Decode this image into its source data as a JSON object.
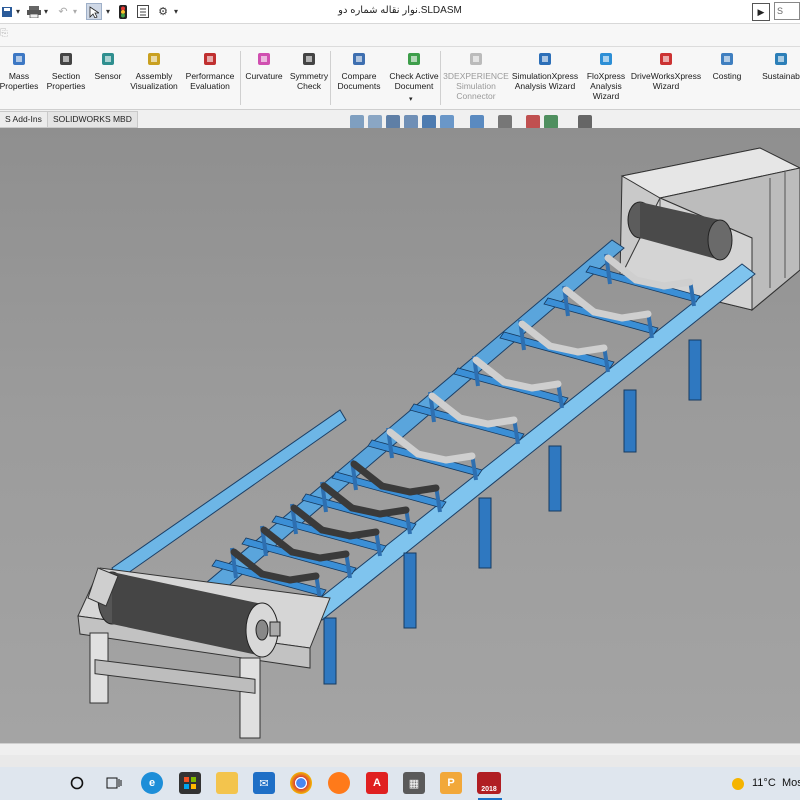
{
  "window": {
    "title": "نوار نقاله شماره دو.SLDASM"
  },
  "search": {
    "placeholder": "S"
  },
  "ribbon": {
    "buttons": [
      {
        "label": "Mass\nProperties",
        "icon": "mass-properties-icon"
      },
      {
        "label": "Section\nProperties",
        "icon": "section-properties-icon"
      },
      {
        "label": "Sensor",
        "icon": "sensor-icon"
      },
      {
        "label": "Assembly\nVisualization",
        "icon": "assembly-visualization-icon"
      },
      {
        "label": "Performance\nEvaluation",
        "icon": "performance-evaluation-icon"
      },
      {
        "label": "Curvature",
        "icon": "curvature-icon"
      },
      {
        "label": "Symmetry\nCheck",
        "icon": "symmetry-check-icon"
      },
      {
        "label": "Compare\nDocuments",
        "icon": "compare-documents-icon"
      },
      {
        "label": "Check Active\nDocument",
        "icon": "check-active-document-icon"
      },
      {
        "label": "3DEXPERIENCE\nSimulation\nConnector",
        "icon": "3dexperience-icon",
        "disabled": true
      },
      {
        "label": "SimulationXpress\nAnalysis Wizard",
        "icon": "simulationxpress-icon"
      },
      {
        "label": "FloXpress\nAnalysis\nWizard",
        "icon": "floxpress-icon"
      },
      {
        "label": "DriveWorksXpress\nWizard",
        "icon": "driveworksxpress-icon"
      },
      {
        "label": "Costing",
        "icon": "costing-icon"
      },
      {
        "label": "Sustainab",
        "icon": "sustainability-icon"
      }
    ]
  },
  "tabs": [
    {
      "label": "S Add-Ins"
    },
    {
      "label": "SOLIDWORKS MBD"
    }
  ],
  "taskbar": {
    "weather": "11°C",
    "weather_text": "Mos",
    "apps": [
      "start",
      "task-view",
      "edge",
      "store",
      "file-explorer",
      "mail",
      "chrome",
      "firefox",
      "acrobat",
      "calculator",
      "powerpoint",
      "solidworks"
    ],
    "solidworks_badge": "2018"
  }
}
